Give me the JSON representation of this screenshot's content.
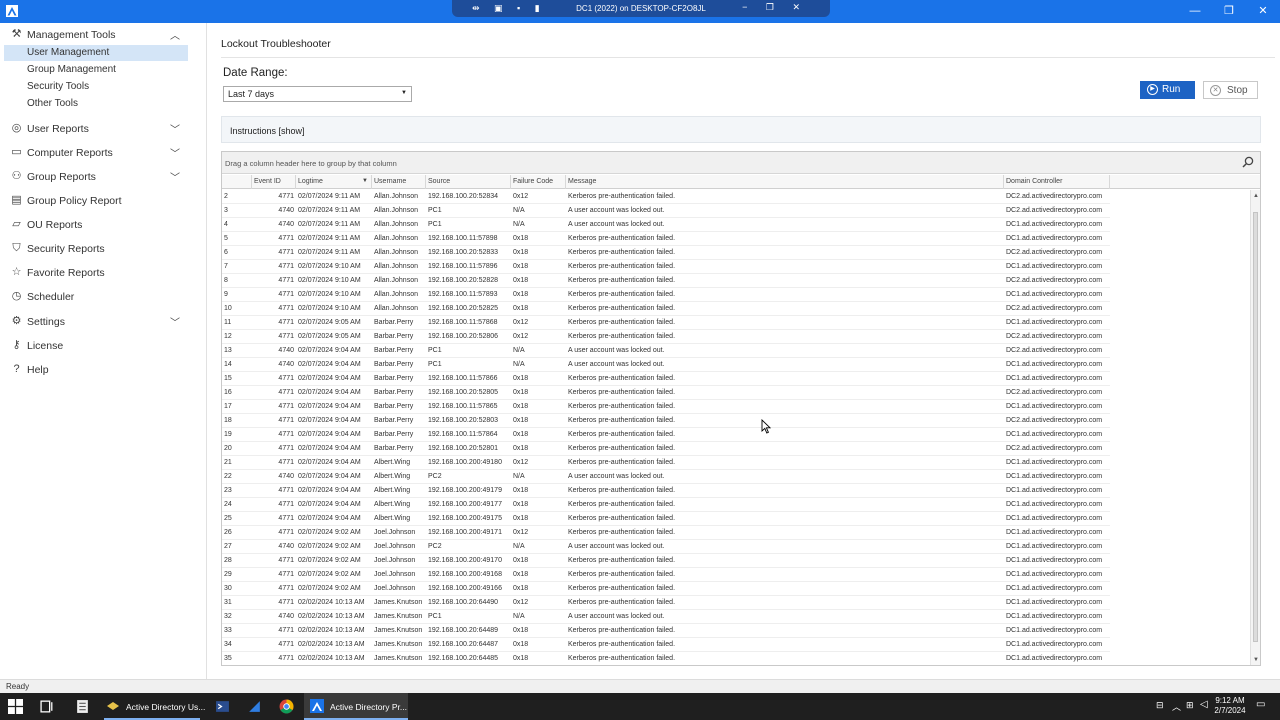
{
  "titlebar": {
    "remote_title": "DC1 (2022) on DESKTOP-CF2O8JL",
    "minimize": "—",
    "maximize": "❐",
    "close": "✕"
  },
  "sidebar": {
    "sections": [
      {
        "label": "Management Tools",
        "icon": "wrench-icon"
      },
      {
        "label": "User Reports",
        "icon": "user-icon"
      },
      {
        "label": "Computer Reports",
        "icon": "monitor-icon"
      },
      {
        "label": "Group Reports",
        "icon": "group-icon"
      },
      {
        "label": "Group Policy Report",
        "icon": "document-icon"
      },
      {
        "label": "OU Reports",
        "icon": "folder-icon"
      },
      {
        "label": "Security Reports",
        "icon": "shield-icon"
      },
      {
        "label": "Favorite Reports",
        "icon": "star-icon"
      },
      {
        "label": "Scheduler",
        "icon": "clock-icon"
      },
      {
        "label": "Settings",
        "icon": "gear-icon"
      },
      {
        "label": "License",
        "icon": "key-icon"
      },
      {
        "label": "Help",
        "icon": "question-icon"
      }
    ],
    "sub_items": [
      "User Management",
      "Group Management",
      "Security Tools",
      "Other Tools"
    ]
  },
  "main": {
    "title": "Lockout Troubleshooter",
    "date_range_label": "Date Range:",
    "date_range_value": "Last 7 days",
    "run_label": "Run",
    "stop_label": "Stop",
    "instructions": "Instructions [show]",
    "group_panel_text": "Drag a column header here to group by that column"
  },
  "grid": {
    "columns": [
      "Event ID",
      "Logtime",
      "Username",
      "Source",
      "Failure Code",
      "Message",
      "Domain Controller"
    ],
    "rows": [
      [
        "2",
        "4771",
        "02/07/2024 9:11 AM",
        "Allan.Johnson",
        "192.168.100.20:52834",
        "0x12",
        "Kerberos pre-authentication failed.",
        "DC2.ad.activedirectorypro.com"
      ],
      [
        "3",
        "4740",
        "02/07/2024 9:11 AM",
        "Allan.Johnson",
        "PC1",
        "N/A",
        "A user account was locked out.",
        "DC2.ad.activedirectorypro.com"
      ],
      [
        "4",
        "4740",
        "02/07/2024 9:11 AM",
        "Allan.Johnson",
        "PC1",
        "N/A",
        "A user account was locked out.",
        "DC1.ad.activedirectorypro.com"
      ],
      [
        "5",
        "4771",
        "02/07/2024 9:11 AM",
        "Allan.Johnson",
        "192.168.100.11:57898",
        "0x18",
        "Kerberos pre-authentication failed.",
        "DC1.ad.activedirectorypro.com"
      ],
      [
        "6",
        "4771",
        "02/07/2024 9:11 AM",
        "Allan.Johnson",
        "192.168.100.20:52833",
        "0x18",
        "Kerberos pre-authentication failed.",
        "DC2.ad.activedirectorypro.com"
      ],
      [
        "7",
        "4771",
        "02/07/2024 9:10 AM",
        "Allan.Johnson",
        "192.168.100.11:57896",
        "0x18",
        "Kerberos pre-authentication failed.",
        "DC1.ad.activedirectorypro.com"
      ],
      [
        "8",
        "4771",
        "02/07/2024 9:10 AM",
        "Allan.Johnson",
        "192.168.100.20:52828",
        "0x18",
        "Kerberos pre-authentication failed.",
        "DC2.ad.activedirectorypro.com"
      ],
      [
        "9",
        "4771",
        "02/07/2024 9:10 AM",
        "Allan.Johnson",
        "192.168.100.11:57893",
        "0x18",
        "Kerberos pre-authentication failed.",
        "DC1.ad.activedirectorypro.com"
      ],
      [
        "10",
        "4771",
        "02/07/2024 9:10 AM",
        "Allan.Johnson",
        "192.168.100.20:52825",
        "0x18",
        "Kerberos pre-authentication failed.",
        "DC2.ad.activedirectorypro.com"
      ],
      [
        "11",
        "4771",
        "02/07/2024 9:05 AM",
        "Barbar.Perry",
        "192.168.100.11:57868",
        "0x12",
        "Kerberos pre-authentication failed.",
        "DC1.ad.activedirectorypro.com"
      ],
      [
        "12",
        "4771",
        "02/07/2024 9:05 AM",
        "Barbar.Perry",
        "192.168.100.20:52806",
        "0x12",
        "Kerberos pre-authentication failed.",
        "DC2.ad.activedirectorypro.com"
      ],
      [
        "13",
        "4740",
        "02/07/2024 9:04 AM",
        "Barbar.Perry",
        "PC1",
        "N/A",
        "A user account was locked out.",
        "DC2.ad.activedirectorypro.com"
      ],
      [
        "14",
        "4740",
        "02/07/2024 9:04 AM",
        "Barbar.Perry",
        "PC1",
        "N/A",
        "A user account was locked out.",
        "DC1.ad.activedirectorypro.com"
      ],
      [
        "15",
        "4771",
        "02/07/2024 9:04 AM",
        "Barbar.Perry",
        "192.168.100.11:57866",
        "0x18",
        "Kerberos pre-authentication failed.",
        "DC1.ad.activedirectorypro.com"
      ],
      [
        "16",
        "4771",
        "02/07/2024 9:04 AM",
        "Barbar.Perry",
        "192.168.100.20:52805",
        "0x18",
        "Kerberos pre-authentication failed.",
        "DC2.ad.activedirectorypro.com"
      ],
      [
        "17",
        "4771",
        "02/07/2024 9:04 AM",
        "Barbar.Perry",
        "192.168.100.11:57865",
        "0x18",
        "Kerberos pre-authentication failed.",
        "DC1.ad.activedirectorypro.com"
      ],
      [
        "18",
        "4771",
        "02/07/2024 9:04 AM",
        "Barbar.Perry",
        "192.168.100.20:52803",
        "0x18",
        "Kerberos pre-authentication failed.",
        "DC2.ad.activedirectorypro.com"
      ],
      [
        "19",
        "4771",
        "02/07/2024 9:04 AM",
        "Barbar.Perry",
        "192.168.100.11:57864",
        "0x18",
        "Kerberos pre-authentication failed.",
        "DC1.ad.activedirectorypro.com"
      ],
      [
        "20",
        "4771",
        "02/07/2024 9:04 AM",
        "Barbar.Perry",
        "192.168.100.20:52801",
        "0x18",
        "Kerberos pre-authentication failed.",
        "DC2.ad.activedirectorypro.com"
      ],
      [
        "21",
        "4771",
        "02/07/2024 9:04 AM",
        "Albert.Wing",
        "192.168.100.200:49180",
        "0x12",
        "Kerberos pre-authentication failed.",
        "DC1.ad.activedirectorypro.com"
      ],
      [
        "22",
        "4740",
        "02/07/2024 9:04 AM",
        "Albert.Wing",
        "PC2",
        "N/A",
        "A user account was locked out.",
        "DC1.ad.activedirectorypro.com"
      ],
      [
        "23",
        "4771",
        "02/07/2024 9:04 AM",
        "Albert.Wing",
        "192.168.100.200:49179",
        "0x18",
        "Kerberos pre-authentication failed.",
        "DC1.ad.activedirectorypro.com"
      ],
      [
        "24",
        "4771",
        "02/07/2024 9:04 AM",
        "Albert.Wing",
        "192.168.100.200:49177",
        "0x18",
        "Kerberos pre-authentication failed.",
        "DC1.ad.activedirectorypro.com"
      ],
      [
        "25",
        "4771",
        "02/07/2024 9:04 AM",
        "Albert.Wing",
        "192.168.100.200:49175",
        "0x18",
        "Kerberos pre-authentication failed.",
        "DC1.ad.activedirectorypro.com"
      ],
      [
        "26",
        "4771",
        "02/07/2024 9:02 AM",
        "Joel.Johnson",
        "192.168.100.200:49171",
        "0x12",
        "Kerberos pre-authentication failed.",
        "DC1.ad.activedirectorypro.com"
      ],
      [
        "27",
        "4740",
        "02/07/2024 9:02 AM",
        "Joel.Johnson",
        "PC2",
        "N/A",
        "A user account was locked out.",
        "DC1.ad.activedirectorypro.com"
      ],
      [
        "28",
        "4771",
        "02/07/2024 9:02 AM",
        "Joel.Johnson",
        "192.168.100.200:49170",
        "0x18",
        "Kerberos pre-authentication failed.",
        "DC1.ad.activedirectorypro.com"
      ],
      [
        "29",
        "4771",
        "02/07/2024 9:02 AM",
        "Joel.Johnson",
        "192.168.100.200:49168",
        "0x18",
        "Kerberos pre-authentication failed.",
        "DC1.ad.activedirectorypro.com"
      ],
      [
        "30",
        "4771",
        "02/07/2024 9:02 AM",
        "Joel.Johnson",
        "192.168.100.200:49166",
        "0x18",
        "Kerberos pre-authentication failed.",
        "DC1.ad.activedirectorypro.com"
      ],
      [
        "31",
        "4771",
        "02/02/2024 10:13 AM",
        "James.Knutson",
        "192.168.100.20:64490",
        "0x12",
        "Kerberos pre-authentication failed.",
        "DC1.ad.activedirectorypro.com"
      ],
      [
        "32",
        "4740",
        "02/02/2024 10:13 AM",
        "James.Knutson",
        "PC1",
        "N/A",
        "A user account was locked out.",
        "DC1.ad.activedirectorypro.com"
      ],
      [
        "33",
        "4771",
        "02/02/2024 10:13 AM",
        "James.Knutson",
        "192.168.100.20:64489",
        "0x18",
        "Kerberos pre-authentication failed.",
        "DC1.ad.activedirectorypro.com"
      ],
      [
        "34",
        "4771",
        "02/02/2024 10:13 AM",
        "James.Knutson",
        "192.168.100.20:64487",
        "0x18",
        "Kerberos pre-authentication failed.",
        "DC1.ad.activedirectorypro.com"
      ],
      [
        "35",
        "4771",
        "02/02/2024 10:13 AM",
        "James.Knutson",
        "192.168.100.20:64485",
        "0x18",
        "Kerberos pre-authentication failed.",
        "DC1.ad.activedirectorypro.com"
      ]
    ]
  },
  "statusbar": {
    "text": "Ready"
  },
  "taskbar": {
    "apps": [
      "Active Directory Us...",
      "Active Directory Pr..."
    ],
    "time": "9:12 AM",
    "date": "2/7/2024"
  },
  "colors": {
    "titlebar": "#1a73e8",
    "accent": "#1d63c4",
    "selected": "#d4e5f7"
  }
}
